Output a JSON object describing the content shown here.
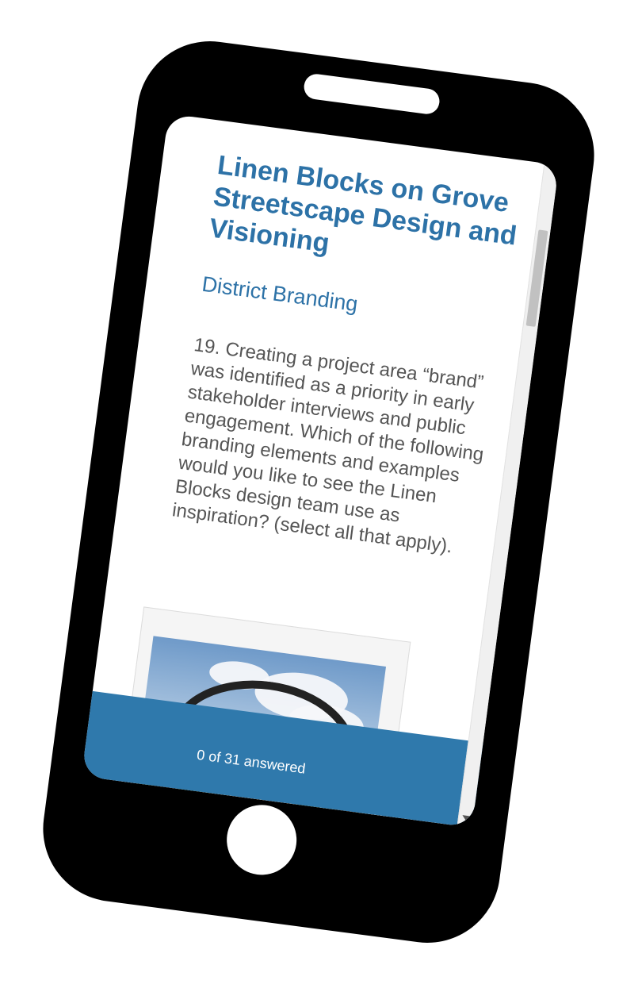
{
  "survey": {
    "title": "Linen Blocks on Grove Streetscape Design and Visioning",
    "page_title": "District Branding",
    "question_text": "19. Creating a project area “brand” was identified as a priority in early stakeholder interviews and public engagement. Which of the following branding elements and examples would you like to see the Linen Blocks design team use as inspiration? (select all that apply)."
  },
  "progress": {
    "label": "0 of 31 answered"
  },
  "colors": {
    "accent": "#2f79ac",
    "heading": "#2d72a7",
    "body_text": "#555555",
    "phone_frame": "#000000"
  },
  "icons": {
    "scroll_down": "chevron-down-icon"
  }
}
